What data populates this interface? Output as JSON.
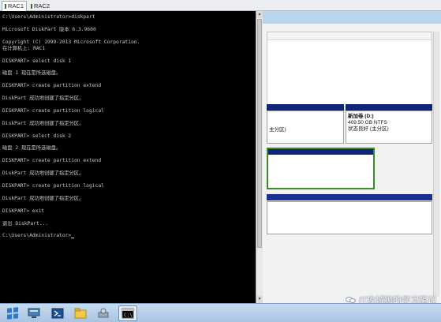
{
  "tabs": [
    {
      "label": "RAC1",
      "active": true
    },
    {
      "label": "RAC2",
      "active": false
    }
  ],
  "console": {
    "lines": [
      "C:\\Users\\Administrator>diskpart",
      "",
      "Microsoft DiskPart 版本 6.3.9600",
      "",
      "Copyright (C) 1999-2013 Microsoft Corporation.",
      "在计算机上: RAC1",
      "",
      "DISKPART> select disk 1",
      "",
      "磁盘 1 现在是所选磁盘。",
      "",
      "DISKPART> create partition extend",
      "",
      "DiskPart 成功地创建了指定分区。",
      "",
      "DISKPART> create partition logical",
      "",
      "DiskPart 成功地创建了指定分区。",
      "",
      "DISKPART> select disk 2",
      "",
      "磁盘 2 现在是所选磁盘。",
      "",
      "DISKPART> create partition extend",
      "",
      "DiskPart 成功地创建了指定分区。",
      "",
      "DISKPART> create partition logical",
      "",
      "DiskPart 成功地创建了指定分区。",
      "",
      "DISKPART> exit",
      "",
      "退出 DiskPart...",
      "",
      "C:\\Users\\Administrator>"
    ]
  },
  "disk_mgmt": {
    "volume_name": "新加卷 (D:)",
    "volume_size": "409.50 GB NTFS",
    "volume_status": "状态良好 (主分区)",
    "partial_status": "主分区)"
  },
  "watermark": {
    "text": "IT攻城狮的学习笔记"
  },
  "taskbar": {
    "items": [
      "start-icon",
      "server-manager-icon",
      "powershell-icon",
      "file-explorer-icon",
      "disk-tools-icon",
      "command-prompt-icon"
    ]
  }
}
